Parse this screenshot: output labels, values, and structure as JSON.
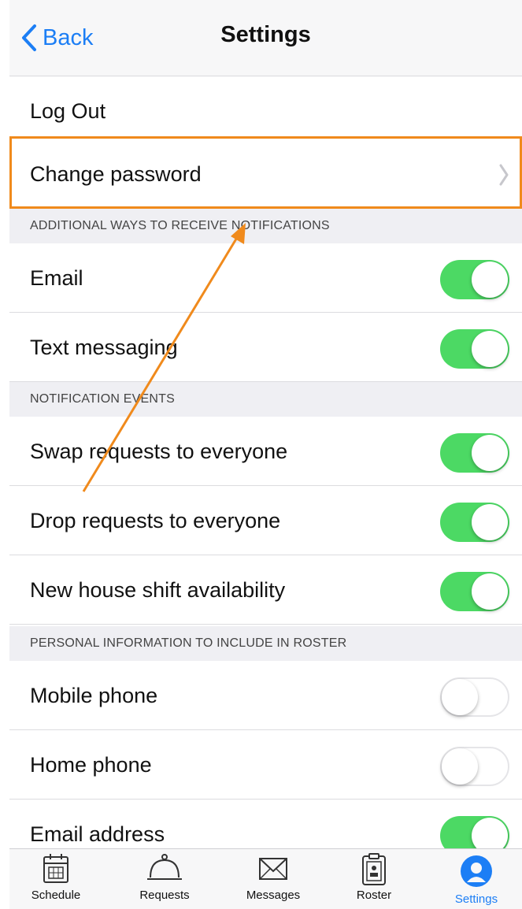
{
  "nav": {
    "back_label": "Back",
    "title": "Settings"
  },
  "account": {
    "logout_label": "Log Out",
    "change_password_label": "Change password"
  },
  "sections": {
    "additional": "ADDITIONAL WAYS TO RECEIVE NOTIFICATIONS",
    "events": "NOTIFICATION EVENTS",
    "personal": "PERSONAL INFORMATION TO INCLUDE IN ROSTER"
  },
  "rows": {
    "email": {
      "label": "Email",
      "on": true
    },
    "text_messaging": {
      "label": "Text messaging",
      "on": true
    },
    "swap_requests": {
      "label": "Swap requests to everyone",
      "on": true
    },
    "drop_requests": {
      "label": "Drop requests to everyone",
      "on": true
    },
    "house_shift": {
      "label": "New house shift availability",
      "on": true
    },
    "mobile_phone": {
      "label": "Mobile phone",
      "on": false
    },
    "home_phone": {
      "label": "Home phone",
      "on": false
    },
    "email_address": {
      "label": "Email address",
      "on": true
    }
  },
  "tabs": [
    {
      "label": "Schedule",
      "icon": "calendar-icon"
    },
    {
      "label": "Requests",
      "icon": "service-bell-icon"
    },
    {
      "label": "Messages",
      "icon": "envelope-icon"
    },
    {
      "label": "Roster",
      "icon": "clipboard-icon"
    },
    {
      "label": "Settings",
      "icon": "user-icon",
      "active": true
    }
  ],
  "colors": {
    "accent": "#1c7ef5",
    "toggle_on": "#4cd964",
    "annotation": "#f08a1c"
  }
}
